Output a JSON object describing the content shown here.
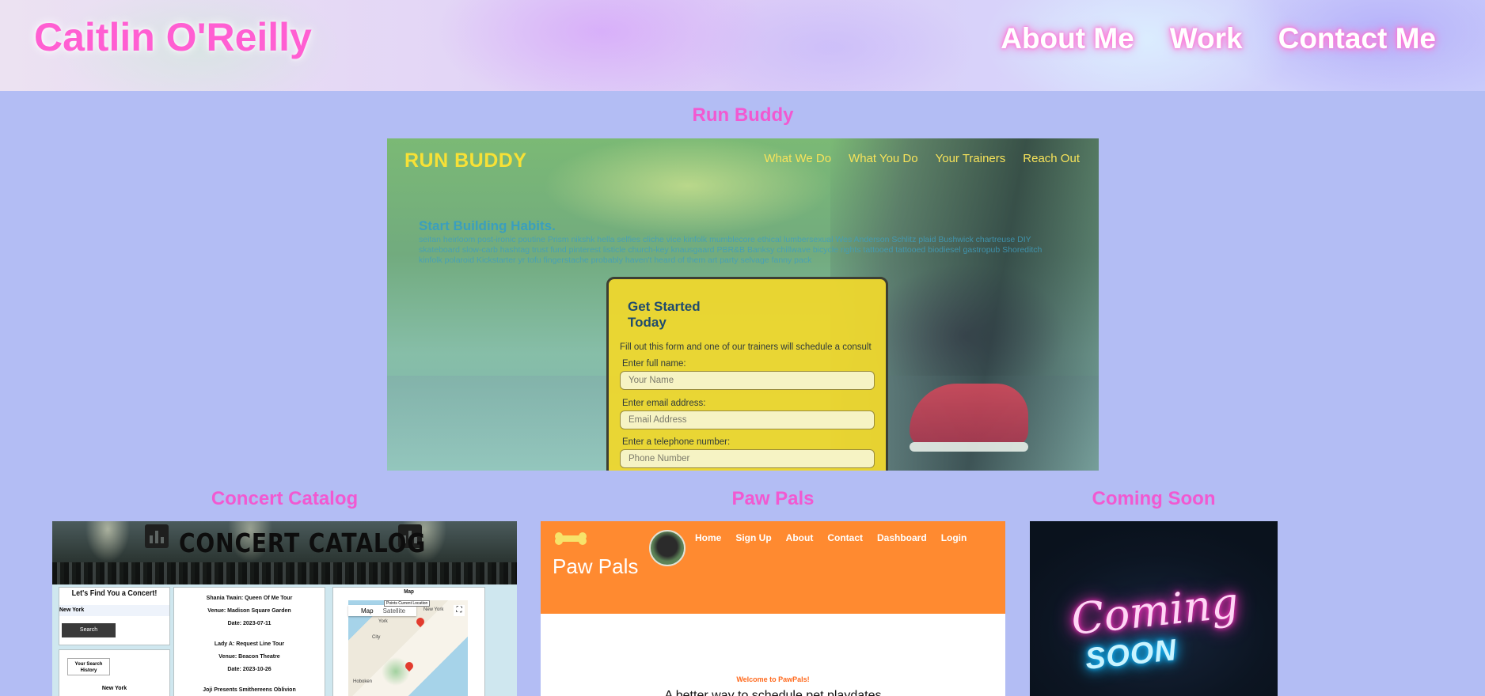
{
  "header": {
    "brand": "Caitlin O'Reilly",
    "nav": [
      "About Me",
      "Work",
      "Contact Me"
    ]
  },
  "colors": {
    "page_bg": "#b3bdf4",
    "accent_pink": "#f159d1",
    "brand_pink": "#ff5fd2"
  },
  "projects": {
    "run_buddy": {
      "title": "Run Buddy",
      "logo": "RUN BUDDY",
      "nav": [
        "What We Do",
        "What You Do",
        "Your Trainers",
        "Reach Out"
      ],
      "hero_title": "Start Building Habits.",
      "hero_text": "seitan heirloom post-ironic poutine Prism nikshk hella selfies cliche vice kinfolk mumblecore ethical lumbersexual Wes Anderson Schlitz plaid Bushwick chartreuse DIY skateboard slow-carb hashtag trust fund pinterest listicle church-key knausgaard PBR&B Banksy chillwave bicycle rights tattooed tattooed biodiesel gastropub Shoreditch kinfolk polaroid Kickstarter yr tofu fingerstache probably haven't heard of them art party selvage fanny pack",
      "form": {
        "title": "Get Started Today",
        "description": "Fill out this form and one of our trainers will schedule a consult",
        "fields": [
          {
            "label": "Enter full name:",
            "placeholder": "Your Name"
          },
          {
            "label": "Enter email address:",
            "placeholder": "Email Address"
          },
          {
            "label": "Enter a telephone number:",
            "placeholder": "Phone Number"
          }
        ]
      }
    },
    "concert_catalog": {
      "title": "Concert Catalog",
      "banner": "CONCERT CATALOG",
      "search_heading": "Let's Find You a Concert!",
      "search_value": "New York",
      "search_button": "Search",
      "history_button": "Your Search History",
      "history_item": "New York",
      "events": [
        {
          "name": "Shania Twain: Queen Of Me Tour",
          "venue": "Venue: Madison Square Garden",
          "date": "Date: 2023-07-11"
        },
        {
          "name": "Lady A: Request Line Tour",
          "venue": "Venue: Beacon Theatre",
          "date": "Date: 2023-10-26"
        },
        {
          "name": "Joji Presents Smithereens Oblivion",
          "venue": "",
          "date": ""
        }
      ],
      "map_heading": "Map",
      "map_tabs": [
        "Map",
        "Satellite"
      ],
      "map_tooltip": "Points Current Location",
      "map_labels": [
        "New York",
        "York",
        "City",
        "Hoboken"
      ]
    },
    "paw_pals": {
      "title": "Paw Pals",
      "brand": "Paw Pals",
      "nav": [
        "Home",
        "Sign Up",
        "About",
        "Contact",
        "Dashboard",
        "Login"
      ],
      "welcome": "Welcome to PawPals!",
      "tagline": "A better way to schedule pet playdates"
    },
    "coming_soon": {
      "title": "Coming Soon",
      "line1": "Coming",
      "line2": "SOON"
    }
  }
}
